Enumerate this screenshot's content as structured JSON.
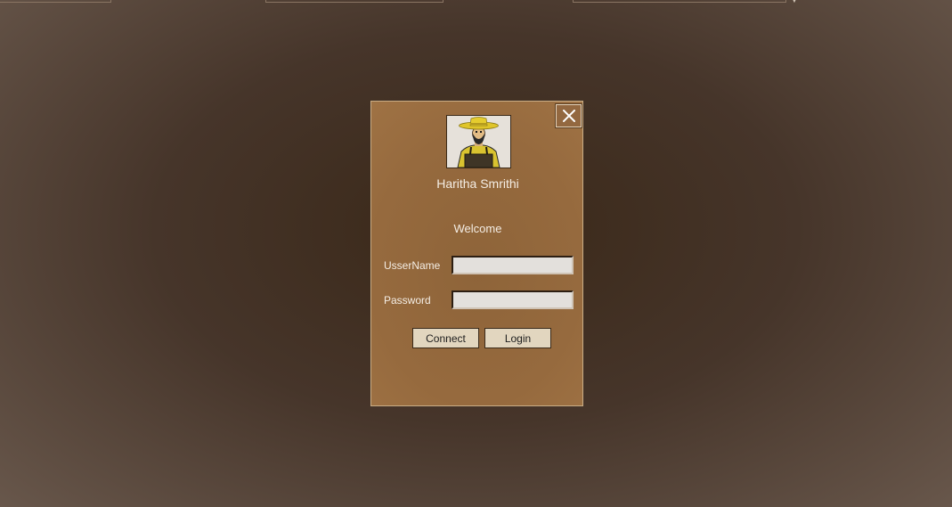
{
  "app": {
    "title": "Haritha Smrithi",
    "welcome": "Welcome"
  },
  "form": {
    "username_label": "UsserName",
    "username_value": "",
    "password_label": "Password",
    "password_value": ""
  },
  "buttons": {
    "connect_label": "Connect",
    "login_label": "Login"
  },
  "icons": {
    "close": "close-icon",
    "avatar": "farmer-avatar-icon",
    "background_dropdown": "chevron-down-icon"
  },
  "colors": {
    "background_center": "#3a2818",
    "background_edge": "#6d5c50",
    "dialog": "#966a3e",
    "button": "#e2d6bf",
    "input": "#e3e0dc",
    "text": "#f4ede4"
  }
}
